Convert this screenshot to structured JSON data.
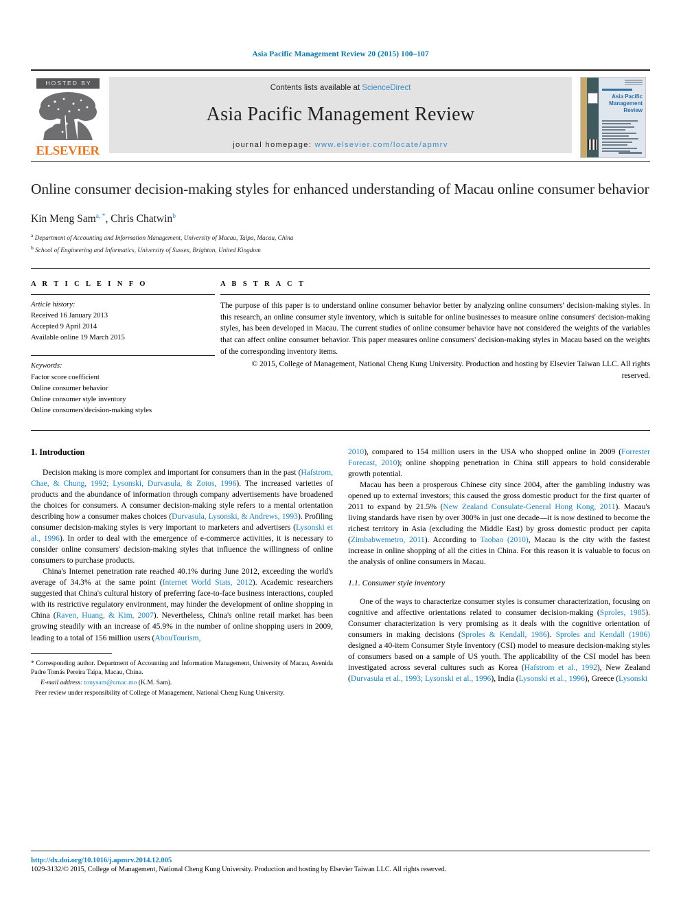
{
  "running_head": "Asia Pacific Management Review 20 (2015) 100–107",
  "masthead": {
    "hosted_by": "HOSTED BY",
    "publisher": "ELSEVIER",
    "contents_prefix": "Contents lists available at ",
    "contents_link": "ScienceDirect",
    "journal_name": "Asia Pacific Management Review",
    "homepage_prefix": "journal homepage: ",
    "homepage_url": "www.elsevier.com/locate/apmrv",
    "cover": {
      "title_line1": "Asia Pacific",
      "title_line2": "Management Review"
    }
  },
  "article": {
    "title": "Online consumer decision-making styles for enhanced understanding of Macau online consumer behavior",
    "authors": "Kin Meng Sam , Chris Chatwin",
    "author_1": "Kin Meng Sam",
    "author_1_sup": "a, *",
    "author_2": "Chris Chatwin",
    "author_2_sup": "b",
    "affiliation_a_sup": "a",
    "affiliation_a": "Department of Accounting and Information Management, University of Macau, Taipa, Macau, China",
    "affiliation_b_sup": "b",
    "affiliation_b": "School of Engineering and Informatics, University of Sussex, Brighton, United Kingdom"
  },
  "article_info": {
    "heading": "A R T I C L E   I N F O",
    "history_label": "Article history:",
    "received": "Received 16 January 2013",
    "accepted": "Accepted 9 April 2014",
    "available": "Available online 19 March 2015",
    "keywords_label": "Keywords:",
    "keywords": [
      "Factor score coefficient",
      "Online consumer behavior",
      "Online consumer style inventory",
      "Online consumers'decision-making styles"
    ]
  },
  "abstract": {
    "heading": "A B S T R A C T",
    "text": "The purpose of this paper is to understand online consumer behavior better by analyzing online consumers' decision-making styles. In this research, an online consumer style inventory, which is suitable for online businesses to measure online consumers' decision-making styles, has been developed in Macau. The current studies of online consumer behavior have not considered the weights of the variables that can affect online consumer behavior. This paper measures online consumers' decision-making styles in Macau based on the weights of the corresponding inventory items.",
    "copyright": "© 2015, College of Management, National Cheng Kung University. Production and hosting by Elsevier Taiwan LLC. All rights reserved."
  },
  "body": {
    "section1_heading": "1. Introduction",
    "section11_heading": "1.1. Consumer style inventory",
    "left_paragraphs": [
      {
        "parts": [
          {
            "t": "Decision making is more complex and important for consumers than in the past (",
            "ref": false
          },
          {
            "t": "Hafstrom, Chae, & Chung, 1992; Lysonski, Durvasula, & Zotos, 1996",
            "ref": true
          },
          {
            "t": "). The increased varieties of products and the abundance of information through company advertisements have broadened the choices for consumers. A consumer decision-making style refers to a mental orientation describing how a consumer makes choices (",
            "ref": false
          },
          {
            "t": "Durvasula, Lysonski, & Andrews, 1993",
            "ref": true
          },
          {
            "t": "). Profiling consumer decision-making styles is very important to marketers and advertisers (",
            "ref": false
          },
          {
            "t": "Lysonski et al., 1996",
            "ref": true
          },
          {
            "t": "). In order to deal with the emergence of e-commerce activities, it is necessary to consider online consumers' decision-making styles that influence the willingness of online consumers to purchase products.",
            "ref": false
          }
        ]
      },
      {
        "parts": [
          {
            "t": "China's Internet penetration rate reached 40.1% during June 2012, exceeding the world's average of 34.3% at the same point (",
            "ref": false
          },
          {
            "t": "Internet World Stats, 2012",
            "ref": true
          },
          {
            "t": "). Academic researchers suggested that China's cultural history of preferring face-to-face business interactions, coupled with its restrictive regulatory environment, may hinder the development of online shopping in China (",
            "ref": false
          },
          {
            "t": "Raven, Huang, & Kim, 2007",
            "ref": true
          },
          {
            "t": "). Nevertheless, China's online retail market has been growing steadily with an increase of 45.9% in the number of online shopping users in 2009, leading to a total of 156 million users (",
            "ref": false
          },
          {
            "t": "AbouTourism,",
            "ref": true
          }
        ]
      }
    ],
    "right_paragraphs": [
      {
        "continued": true,
        "parts": [
          {
            "t": "2010",
            "ref": true
          },
          {
            "t": "), compared to 154 million users in the USA who shopped online in 2009 (",
            "ref": false
          },
          {
            "t": "Forrester Forecast, 2010",
            "ref": true
          },
          {
            "t": "); online shopping penetration in China still appears to hold considerable growth potential.",
            "ref": false
          }
        ]
      },
      {
        "parts": [
          {
            "t": "Macau has been a prosperous Chinese city since 2004, after the gambling industry was opened up to external investors; this caused the gross domestic product for the first quarter of 2011 to expand by 21.5% (",
            "ref": false
          },
          {
            "t": "New Zealand Consulate-General Hong Kong, 2011",
            "ref": true
          },
          {
            "t": "). Macau's living standards have risen by over 300% in just one decade—it is now destined to become the richest territory in Asia (excluding the Middle East) by gross domestic product per capita (",
            "ref": false
          },
          {
            "t": "Zimbabwemetro, 2011",
            "ref": true
          },
          {
            "t": "). According to ",
            "ref": false
          },
          {
            "t": "Taobao (2010)",
            "ref": true
          },
          {
            "t": ", Macau is the city with the fastest increase in online shopping of all the cities in China. For this reason it is valuable to focus on the analysis of online consumers in Macau.",
            "ref": false
          }
        ]
      },
      {
        "after_heading": true,
        "parts": [
          {
            "t": "One of the ways to characterize consumer styles is consumer characterization, focusing on cognitive and affective orientations related to consumer decision-making (",
            "ref": false
          },
          {
            "t": "Sproles, 1985",
            "ref": true
          },
          {
            "t": "). Consumer characterization is very promising as it deals with the cognitive orientation of consumers in making decisions (",
            "ref": false
          },
          {
            "t": "Sproles & Kendall, 1986",
            "ref": true
          },
          {
            "t": "). ",
            "ref": false
          },
          {
            "t": "Sproles and Kendall (1986)",
            "ref": true
          },
          {
            "t": " designed a 40-item Consumer Style Inventory (CSI) model to measure decision-making styles of consumers based on a sample of US youth. The applicability of the CSI model has been investigated across several cultures such as Korea (",
            "ref": false
          },
          {
            "t": "Hafstrom et al., 1992",
            "ref": true
          },
          {
            "t": "), New Zealand (",
            "ref": false
          },
          {
            "t": "Durvasula et al., 1993; Lysonski et al., 1996",
            "ref": true
          },
          {
            "t": "), India (",
            "ref": false
          },
          {
            "t": "Lysonski et al., 1996",
            "ref": true
          },
          {
            "t": "), Greece (",
            "ref": false
          },
          {
            "t": "Lysonski",
            "ref": true
          }
        ]
      }
    ]
  },
  "footnotes": {
    "corresponding_star": "*",
    "corresponding": "Corresponding author. Department of Accounting and Information Management, University of Macau, Avenida Padre Tomás Pereira Taipa, Macau, China.",
    "email_label": "E-mail address:",
    "email": "tonysam@umac.mo",
    "email_owner": "(K.M. Sam).",
    "peer_review": "Peer review under responsibility of College of Management, National Cheng Kung University."
  },
  "footer": {
    "doi": "http://dx.doi.org/10.1016/j.apmrv.2014.12.005",
    "issn_copyright": "1029-3132/© 2015, College of Management, National Cheng Kung University. Production and hosting by Elsevier Taiwan LLC. All rights reserved."
  },
  "colors": {
    "link_blue": "#1a7fb5",
    "header_blue": "#0b75a8",
    "sciencedirect_blue": "#3e8bc4",
    "elsevier_orange": "#e87722",
    "banner_gray": "#e3e3e3",
    "hosted_gray": "#58585b"
  }
}
